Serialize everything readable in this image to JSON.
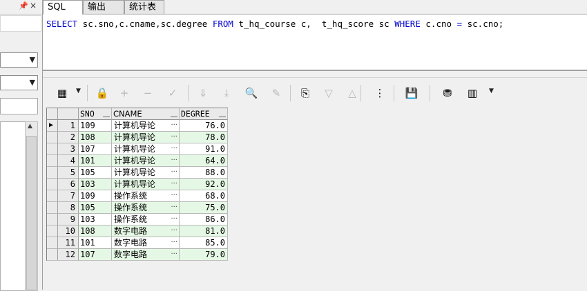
{
  "tabs": [
    {
      "label": "SQL",
      "active": true
    },
    {
      "label": "输出",
      "active": false
    },
    {
      "label": "统计表",
      "active": false
    }
  ],
  "sql": {
    "tokens": [
      {
        "t": "SELECT",
        "kw": true
      },
      {
        "t": " sc.sno,c.cname,sc.degree ",
        "kw": false
      },
      {
        "t": "FROM",
        "kw": true
      },
      {
        "t": " t_hq_course c,  t_hq_score sc ",
        "kw": false
      },
      {
        "t": "WHERE",
        "kw": true
      },
      {
        "t": " c.cno ",
        "kw": false
      },
      {
        "t": "=",
        "kw": true
      },
      {
        "t": " sc.cno;",
        "kw": false
      }
    ]
  },
  "left_pane": {
    "pin_icon": "pin-icon",
    "close_glyph": "×"
  },
  "toolbar": {
    "icons": [
      {
        "name": "grid-view-icon",
        "glyph": "▦",
        "enabled": true
      },
      {
        "name": "lock-icon",
        "glyph": "🔒",
        "enabled": true
      },
      {
        "name": "add-record-icon",
        "glyph": "+",
        "enabled": false
      },
      {
        "name": "delete-record-icon",
        "glyph": "−",
        "enabled": false
      },
      {
        "name": "post-changes-icon",
        "glyph": "✓",
        "enabled": false
      },
      {
        "name": "fetch-next-icon",
        "glyph": "⇓",
        "enabled": false
      },
      {
        "name": "fetch-last-icon",
        "glyph": "⤓",
        "enabled": false
      },
      {
        "name": "find-icon",
        "glyph": "🔍",
        "enabled": true
      },
      {
        "name": "clear-icon",
        "glyph": "✎",
        "enabled": false
      },
      {
        "name": "query-by-example-icon",
        "glyph": "⎘",
        "enabled": true
      },
      {
        "name": "sort-down-icon",
        "glyph": "▽",
        "enabled": false
      },
      {
        "name": "sort-up-icon",
        "glyph": "△",
        "enabled": false
      },
      {
        "name": "tree-view-icon",
        "glyph": "⋮",
        "enabled": true
      },
      {
        "name": "save-icon",
        "glyph": "💾",
        "enabled": true
      },
      {
        "name": "export-icon",
        "glyph": "⛃",
        "enabled": true
      },
      {
        "name": "chart-icon",
        "glyph": "▥",
        "enabled": true
      }
    ]
  },
  "grid": {
    "columns": [
      "SNO",
      "CNAME",
      "DEGREE"
    ],
    "rows": [
      {
        "n": "1",
        "sno": "109",
        "cname": "计算机导论",
        "degree": "76.0"
      },
      {
        "n": "2",
        "sno": "108",
        "cname": "计算机导论",
        "degree": "78.0"
      },
      {
        "n": "3",
        "sno": "107",
        "cname": "计算机导论",
        "degree": "91.0"
      },
      {
        "n": "4",
        "sno": "101",
        "cname": "计算机导论",
        "degree": "64.0"
      },
      {
        "n": "5",
        "sno": "105",
        "cname": "计算机导论",
        "degree": "88.0"
      },
      {
        "n": "6",
        "sno": "103",
        "cname": "计算机导论",
        "degree": "92.0"
      },
      {
        "n": "7",
        "sno": "109",
        "cname": "操作系统",
        "degree": "68.0"
      },
      {
        "n": "8",
        "sno": "105",
        "cname": "操作系统",
        "degree": "75.0"
      },
      {
        "n": "9",
        "sno": "103",
        "cname": "操作系统",
        "degree": "86.0"
      },
      {
        "n": "10",
        "sno": "108",
        "cname": "数字电路",
        "degree": "81.0"
      },
      {
        "n": "11",
        "sno": "101",
        "cname": "数字电路",
        "degree": "85.0"
      },
      {
        "n": "12",
        "sno": "107",
        "cname": "数字电路",
        "degree": "79.0"
      }
    ],
    "ellipsis": "···",
    "current_indicator": "▶"
  }
}
